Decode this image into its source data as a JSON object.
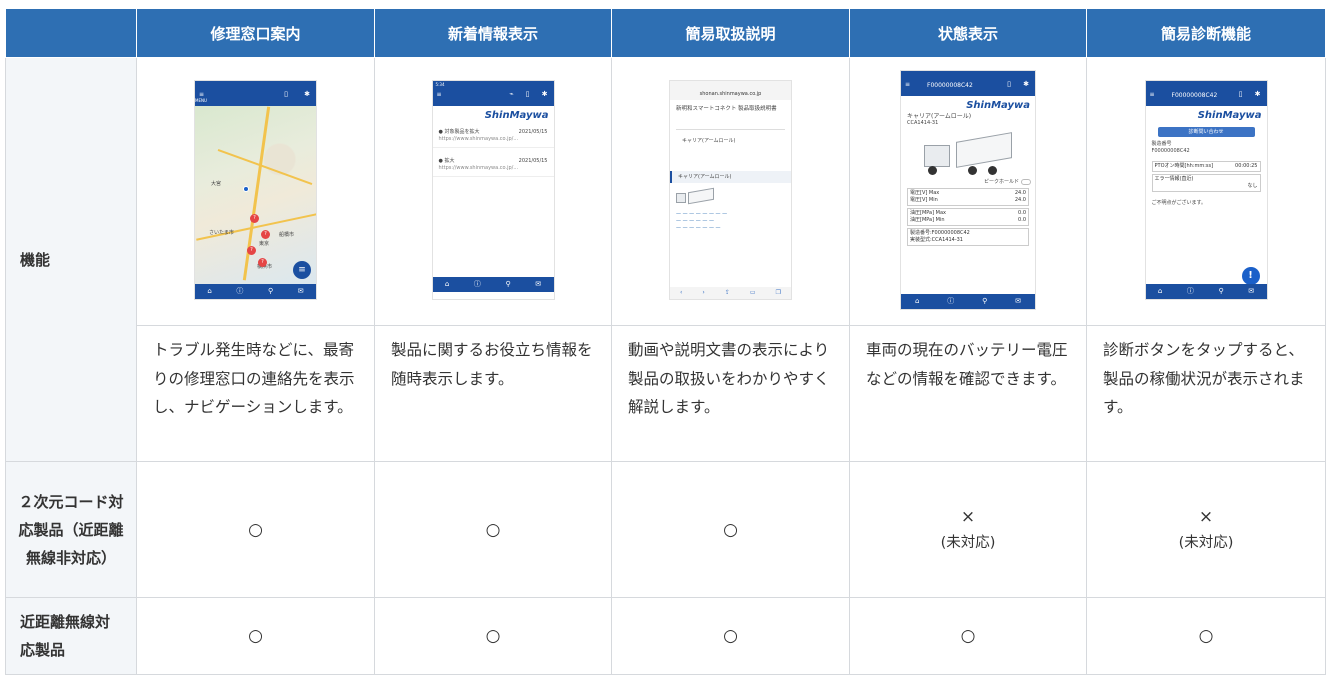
{
  "table": {
    "columns": [
      "修理窓口案内",
      "新着情報表示",
      "簡易取扱説明",
      "状態表示",
      "簡易診断機能"
    ],
    "row_labels": {
      "feature": "機能",
      "qr": "２次元コード対応製品（近距離無線非対応）",
      "near": "近距離無線対応製品"
    },
    "descriptions": [
      "トラブル発生時などに、最寄りの修理窓口の連絡先を表示し、ナビゲーションします。",
      "製品に関するお役立ち情報を随時表示します。",
      "動画や説明文書の表示により製品の取扱いをわかりやすく解説します。",
      "車両の現在のバッテリー電圧などの情報を確認できます。",
      "診断ボタンをタップすると、製品の稼働状況が表示されます。"
    ],
    "qr_support": [
      {
        "mark": "○",
        "note": ""
      },
      {
        "mark": "○",
        "note": ""
      },
      {
        "mark": "○",
        "note": ""
      },
      {
        "mark": "×",
        "note": "(未対応)"
      },
      {
        "mark": "×",
        "note": "(未対応)"
      }
    ],
    "near_support": [
      "○",
      "○",
      "○",
      "○",
      "○"
    ]
  },
  "screens": {
    "repair": {
      "menu": "MENU",
      "labels": [
        "大宮",
        "さいたま市",
        "東京",
        "横浜市",
        "船橋市"
      ],
      "nav": [
        "ホーム",
        "",
        "",
        "修理窓口",
        "お問合せ"
      ]
    },
    "news": {
      "time": "5:34",
      "logo": "ShinMaywa",
      "items": [
        {
          "title": "● 対象製品を拡大",
          "date": "2021/05/15",
          "url": "https://www.shinmaywa.co.jp/..."
        },
        {
          "title": "● 拡大",
          "date": "2021/05/15",
          "url": "https://www.shinmaywa.co.jp/..."
        }
      ],
      "nav": [
        "ホーム",
        "",
        "修理窓口",
        "新着情報"
      ]
    },
    "manual": {
      "url": "shonan.shinmaywa.co.jp",
      "heading": "新明和スマートコネクト 製品取扱説明書",
      "section": "キャリア(アームロール)",
      "section_bar": "キャリア(アームロール)"
    },
    "status": {
      "device_id": "F00000008C42",
      "logo": "ShinMaywa",
      "product": "キャリア(アームロール)",
      "model": "CCA1414-31",
      "peak_hold": "ピークホールド",
      "rows": [
        {
          "k": "電圧[V] Max",
          "v": "24.0"
        },
        {
          "k": "電圧[V] Min",
          "v": "24.0"
        },
        {
          "k": "油圧[MPa] Max",
          "v": "0.0"
        },
        {
          "k": "油圧[MPa] Min",
          "v": "0.0"
        }
      ],
      "serial": "製造番号:F00000008C42",
      "model_line": "実装型式:CCA1414-31",
      "nav": [
        "ホーム",
        "",
        "",
        ""
      ]
    },
    "diag": {
      "device_id": "F00000008C42",
      "logo": "ShinMaywa",
      "button": "診断問い合わせ",
      "serial_label": "製造番号",
      "serial": "F00000008C42",
      "pto_label": "PTOオン時間[hh:mm:ss]",
      "pto_value": "00:00:25",
      "error_label": "エラー情報(直近)",
      "error_value": "なし",
      "note": "ご不明点がございます。",
      "info": "!",
      "nav": [
        "ホーム",
        "",
        "",
        ""
      ]
    }
  },
  "colors": {
    "header_bg": "#2e6fb3",
    "rowhead_bg": "#f3f6f9",
    "app_blue": "#1b4fa0",
    "border": "#d6d9dd"
  }
}
